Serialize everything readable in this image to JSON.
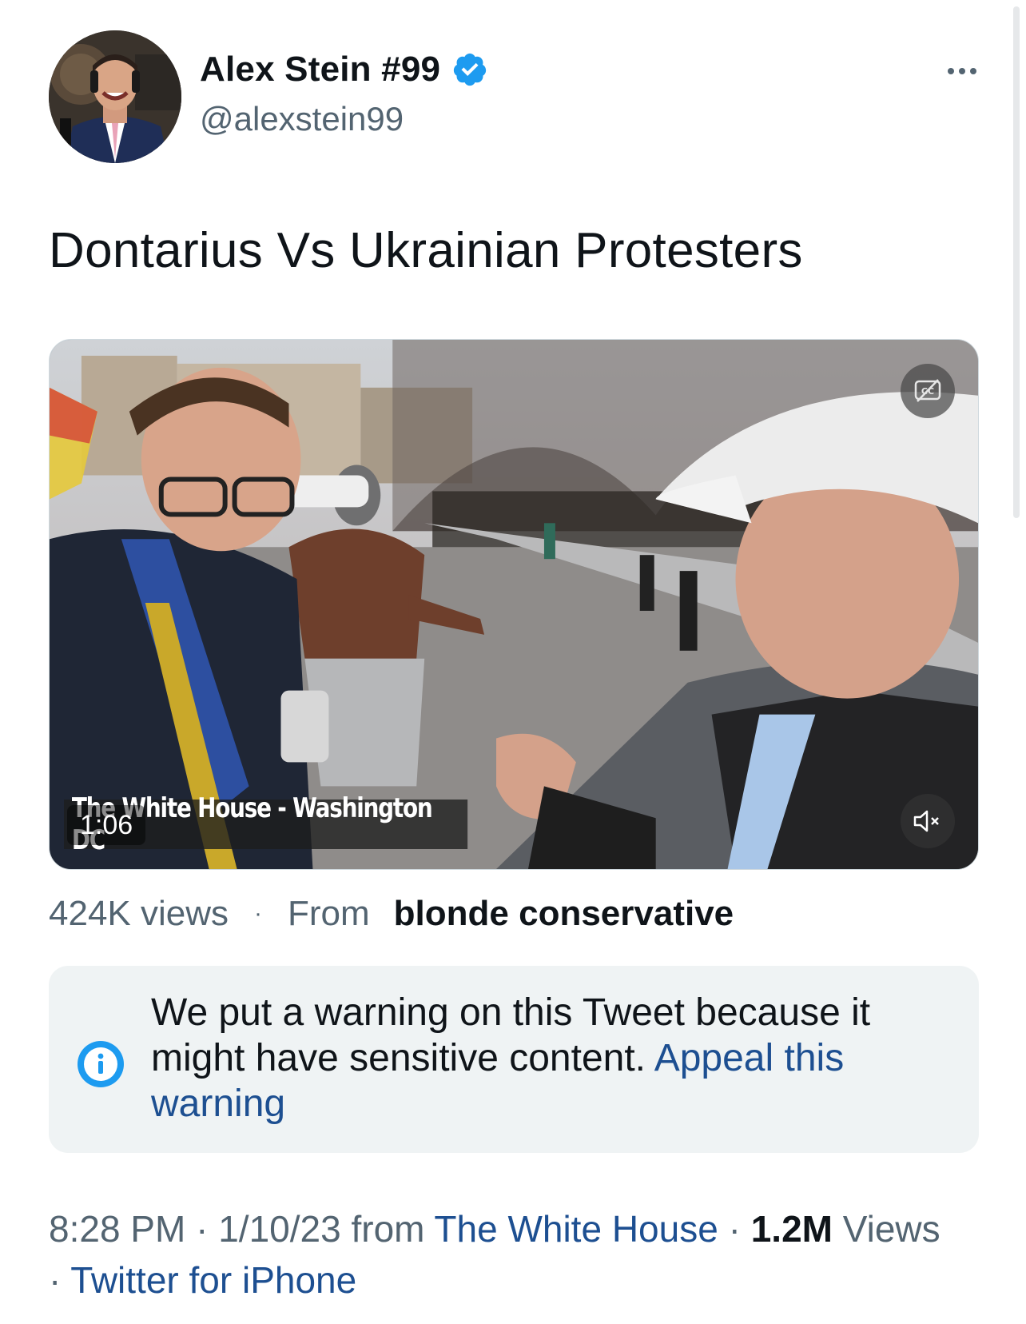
{
  "author": {
    "display_name": "Alex Stein #99",
    "handle": "@alexstein99",
    "verified": true
  },
  "tweet": {
    "text": "Dontarius Vs Ukrainian Protesters"
  },
  "video": {
    "caption": "The White House - Washington DC",
    "duration": "1:06"
  },
  "views": {
    "count": "424K views",
    "separator": "·",
    "from_label": "From",
    "source": "blonde conservative"
  },
  "warning": {
    "text": "We put a warning on this Tweet because it might have sensitive content.",
    "appeal_link": "Appeal this warning"
  },
  "meta": {
    "time": "8:28 PM",
    "date": "1/10/23",
    "from_word": "from",
    "location": "The White House",
    "views_count": "1.2M",
    "views_label": "Views",
    "client": "Twitter for iPhone",
    "dot": "·"
  },
  "colors": {
    "link": "#1d4f91",
    "verified": "#1d9bf0",
    "secondary_text": "#536471",
    "warning_bg": "#eff3f4"
  },
  "icons": [
    "verified-badge-icon",
    "more-icon",
    "closed-captions-icon",
    "muted-speaker-icon",
    "info-icon"
  ]
}
